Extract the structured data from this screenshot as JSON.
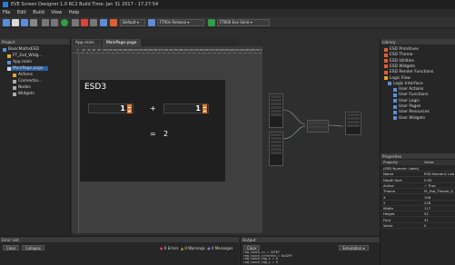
{
  "window": {
    "title": "EVE Screen Designer 1.0 RC2 Build Time: Jan 31 2017 - 17:27:54"
  },
  "menu": [
    "File",
    "Edit",
    "Build",
    "View",
    "Help"
  ],
  "toolbar": {
    "combo1": "Default",
    "combo2": "FT90x Release",
    "combo3": "FT800 Eve Serie"
  },
  "project": {
    "header": "Project",
    "items": [
      {
        "label": "BasicMathsESD",
        "level": 0
      },
      {
        "label": "FT_Esd_Widg...",
        "level": 1
      },
      {
        "label": "App.main",
        "level": 1
      },
      {
        "label": "MainPage.page",
        "level": 1
      },
      {
        "label": "Actions",
        "level": 2
      },
      {
        "label": "Connectio...",
        "level": 2
      },
      {
        "label": "Nodes",
        "level": 2
      },
      {
        "label": "Widgets",
        "level": 2
      }
    ]
  },
  "tabs": [
    {
      "label": "App.main",
      "active": false
    },
    {
      "label": "MainPage.page",
      "active": true
    }
  ],
  "ruler_labels": [
    "0",
    "20",
    "40",
    "60",
    "80",
    "100",
    "120",
    "140",
    "160",
    "180",
    "200",
    "220",
    "240",
    "260",
    "280",
    "300",
    "320",
    "340",
    "360",
    "380",
    "400",
    "420",
    "440",
    "460",
    "480",
    "500",
    "520",
    "540",
    "560",
    "580",
    "600",
    "620",
    "640",
    "660",
    "680",
    "700",
    "720"
  ],
  "screen": {
    "heading": "ESD3",
    "value1": "1",
    "operator": "+",
    "value2": "1",
    "result_label": "=",
    "result": "2"
  },
  "library": {
    "header": "Library",
    "items": [
      {
        "label": "ESD Primitives",
        "color": "#e35d2f"
      },
      {
        "label": "ESD Theme",
        "color": "#e35d2f"
      },
      {
        "label": "ESD Utilities",
        "color": "#e35d2f"
      },
      {
        "label": "ESD Widgets",
        "color": "#e35d2f"
      },
      {
        "label": "ESD Render Functions",
        "color": "#e35d2f"
      },
      {
        "label": "Logic Flow",
        "color": "#e3a52f"
      },
      {
        "label": "Logic Interface",
        "color": "#5b8ed6"
      },
      {
        "label": "User Actions",
        "color": "#5b8ed6"
      },
      {
        "label": "User Functions",
        "color": "#5b8ed6"
      },
      {
        "label": "User Logic",
        "color": "#5b8ed6"
      },
      {
        "label": "User Pages",
        "color": "#5b8ed6"
      },
      {
        "label": "User Resources",
        "color": "#5b8ed6"
      },
      {
        "label": "User Widgets",
        "color": "#5b8ed6"
      }
    ]
  },
  "properties": {
    "header": "Properties",
    "col_property": "Property",
    "col_value": "Value",
    "rows": [
      {
        "name": "(ESD Numeric Label)",
        "value": ""
      },
      {
        "name": "Name",
        "value": "ESD Numeric Lab"
      },
      {
        "name": "Depth Sort",
        "value": "0.00"
      },
      {
        "name": "Active",
        "value": "✓ True"
      },
      {
        "name": "Theme",
        "value": "Ft_Esd_Theme_G"
      },
      {
        "name": "X",
        "value": "106"
      },
      {
        "name": "Y",
        "value": "228"
      },
      {
        "name": "Width",
        "value": "117"
      },
      {
        "name": "Height",
        "value": "52"
      },
      {
        "name": "Font",
        "value": "31"
      },
      {
        "name": "Value",
        "value": "0"
      }
    ]
  },
  "errors": {
    "header": "Error List",
    "clear": "Clear",
    "collapse": "Collapse",
    "err_count": "0 Errors",
    "warn_count": "0 Warnings",
    "msg_count": "0 Messages"
  },
  "output": {
    "header": "Output",
    "clear": "Clear",
    "simulation": "Simulation",
    "lines": [
      "reg_touch_rz = 32767",
      "reg_touch_rzthresh = 0x1DFF",
      "reg_touch_tag_x = 0",
      "reg_touch_tag_y = 0",
      "reg_touch_tag = 0"
    ]
  }
}
